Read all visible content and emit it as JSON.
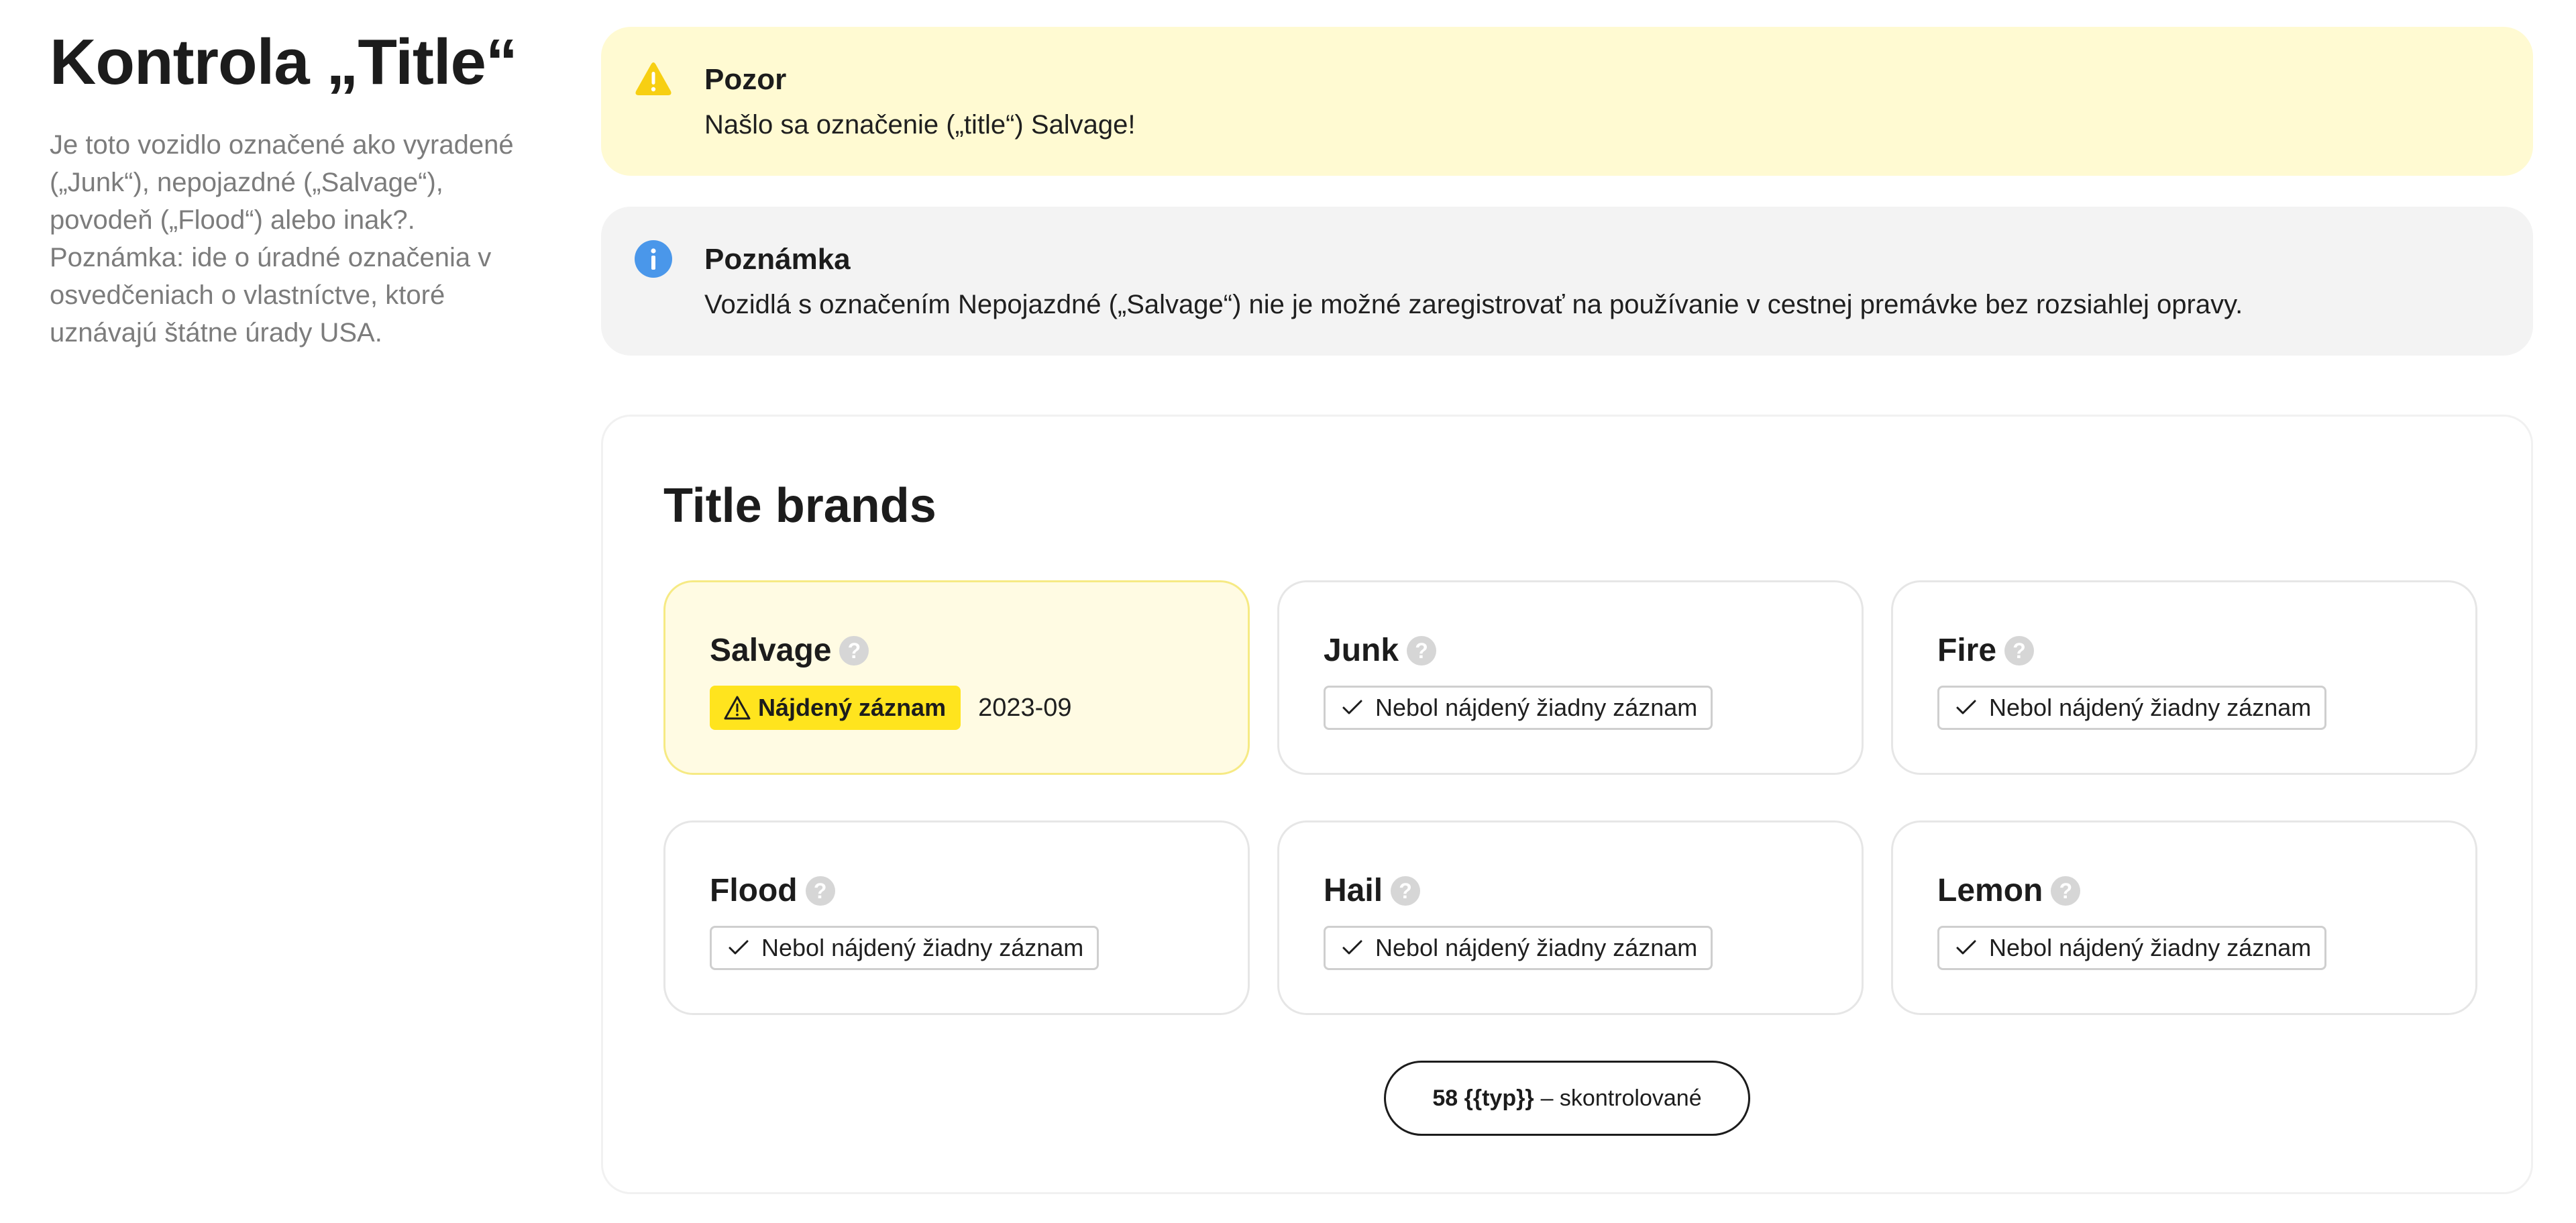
{
  "page": {
    "title": "Kontrola „Title“",
    "description": "Je toto vozidlo označené ako vyradené („Junk“), nepojazdné („Salvage“), povodeň („Flood“) alebo inak?. Poznámka: ide o úradné označenia v osvedčeniach o vlastníctve, ktoré uznávajú štátne úrady USA."
  },
  "alerts": {
    "warning": {
      "icon": "warning-icon",
      "title": "Pozor",
      "text": "Našlo sa označenie („title“) Salvage!",
      "color": "#fffad2"
    },
    "info": {
      "icon": "info-icon",
      "title": "Poznámka",
      "text": "Vozidlá s označením Nepojazdné („Salvage“) nie je možné zaregistrovať na používanie v cestnej premávke bez rozsiahlej opravy.",
      "color": "#f3f3f3"
    }
  },
  "brands": {
    "heading": "Title brands",
    "help_symbol": "?",
    "items": [
      {
        "name": "Salvage",
        "status": "found",
        "badge": "Nájdený záznam",
        "date": "2023-09"
      },
      {
        "name": "Junk",
        "status": "clear",
        "badge": "Nebol nájdený žiadny záznam"
      },
      {
        "name": "Fire",
        "status": "clear",
        "badge": "Nebol nájdený žiadny záznam"
      },
      {
        "name": "Flood",
        "status": "clear",
        "badge": "Nebol nájdený žiadny záznam"
      },
      {
        "name": "Hail",
        "status": "clear",
        "badge": "Nebol nájdený žiadny záznam"
      },
      {
        "name": "Lemon",
        "status": "clear",
        "badge": "Nebol nájdený žiadny záznam"
      }
    ],
    "checked_button": {
      "count_label": "58 {{typ}}",
      "suffix": "– skontrolované"
    }
  },
  "colors": {
    "found_badge": "#ffe41e",
    "found_card": "#fffbe3",
    "info_icon": "#4a97ea",
    "warning_icon": "#f7cf12"
  }
}
